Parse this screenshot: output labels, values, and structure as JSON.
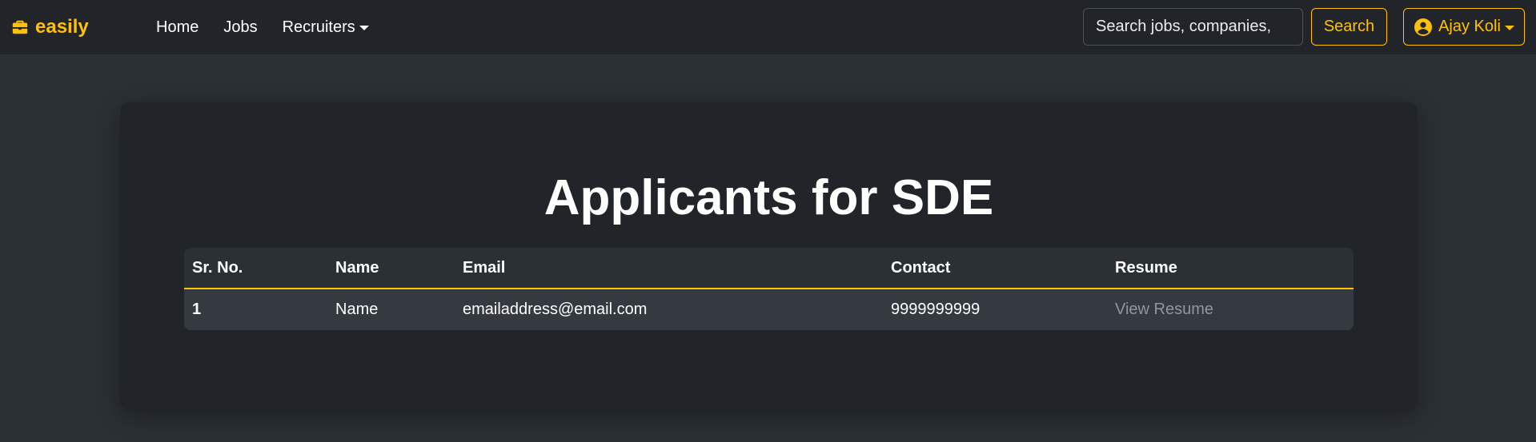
{
  "navbar": {
    "brand": "easily",
    "brand_icon": "briefcase-icon",
    "links": [
      {
        "label": "Home"
      },
      {
        "label": "Jobs"
      },
      {
        "label": "Recruiters"
      }
    ],
    "search": {
      "placeholder": "Search jobs, companies,",
      "value": "",
      "button_label": "Search"
    },
    "user": {
      "name": "Ajay Koli",
      "icon": "user-circle-icon"
    }
  },
  "main": {
    "title": "Applicants for SDE",
    "table": {
      "headers": [
        "Sr. No.",
        "Name",
        "Email",
        "Contact",
        "Resume"
      ],
      "rows": [
        {
          "sr_no": "1",
          "name": "Name",
          "email": "emailaddress@email.com",
          "contact": "9999999999",
          "resume": "View Resume"
        }
      ]
    }
  },
  "colors": {
    "accent": "#ffc107",
    "navbar_bg": "#212529",
    "page_bg": "#2b3035",
    "card_bg": "#212529",
    "row_bg": "#343a40",
    "link_muted": "#8f969c"
  }
}
